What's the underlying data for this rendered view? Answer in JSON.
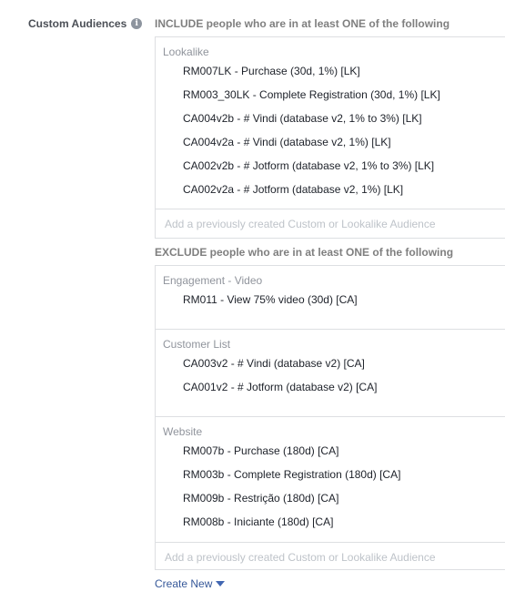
{
  "field": {
    "label": "Custom Audiences",
    "info_icon": "i"
  },
  "include": {
    "heading": "INCLUDE people who are in at least ONE of the following",
    "sections": [
      {
        "title": "Lookalike",
        "items": [
          "RM007LK - Purchase (30d, 1%) [LK]",
          "RM003_30LK - Complete Registration (30d, 1%) [LK]",
          "CA004v2b - # Vindi (database v2, 1% to 3%) [LK]",
          "CA004v2a - # Vindi (database v2, 1%) [LK]",
          "CA002v2b - # Jotform (database v2, 1% to 3%) [LK]",
          "CA002v2a - # Jotform (database v2, 1%) [LK]"
        ]
      }
    ],
    "input_placeholder": "Add a previously created Custom or Lookalike Audience"
  },
  "exclude": {
    "heading": "EXCLUDE people who are in at least ONE of the following",
    "sections": [
      {
        "title": "Engagement - Video",
        "items": [
          "RM011 - View 75% video (30d) [CA]"
        ]
      },
      {
        "title": "Customer List",
        "items": [
          "CA003v2 - # Vindi (database v2) [CA]",
          "CA001v2 - # Jotform (database v2) [CA]"
        ]
      },
      {
        "title": "Website",
        "items": [
          "RM007b - Purchase (180d) [CA]",
          "RM003b - Complete Registration (180d) [CA]",
          "RM009b - Restrição (180d) [CA]",
          "RM008b - Iniciante (180d) [CA]"
        ]
      }
    ],
    "input_placeholder": "Add a previously created Custom or Lookalike Audience"
  },
  "create_new": {
    "label": "Create New"
  },
  "colors": {
    "link": "#365899",
    "heading": "#7f7f7f",
    "border": "#dddfe2",
    "placeholder": "#bec3c9"
  }
}
